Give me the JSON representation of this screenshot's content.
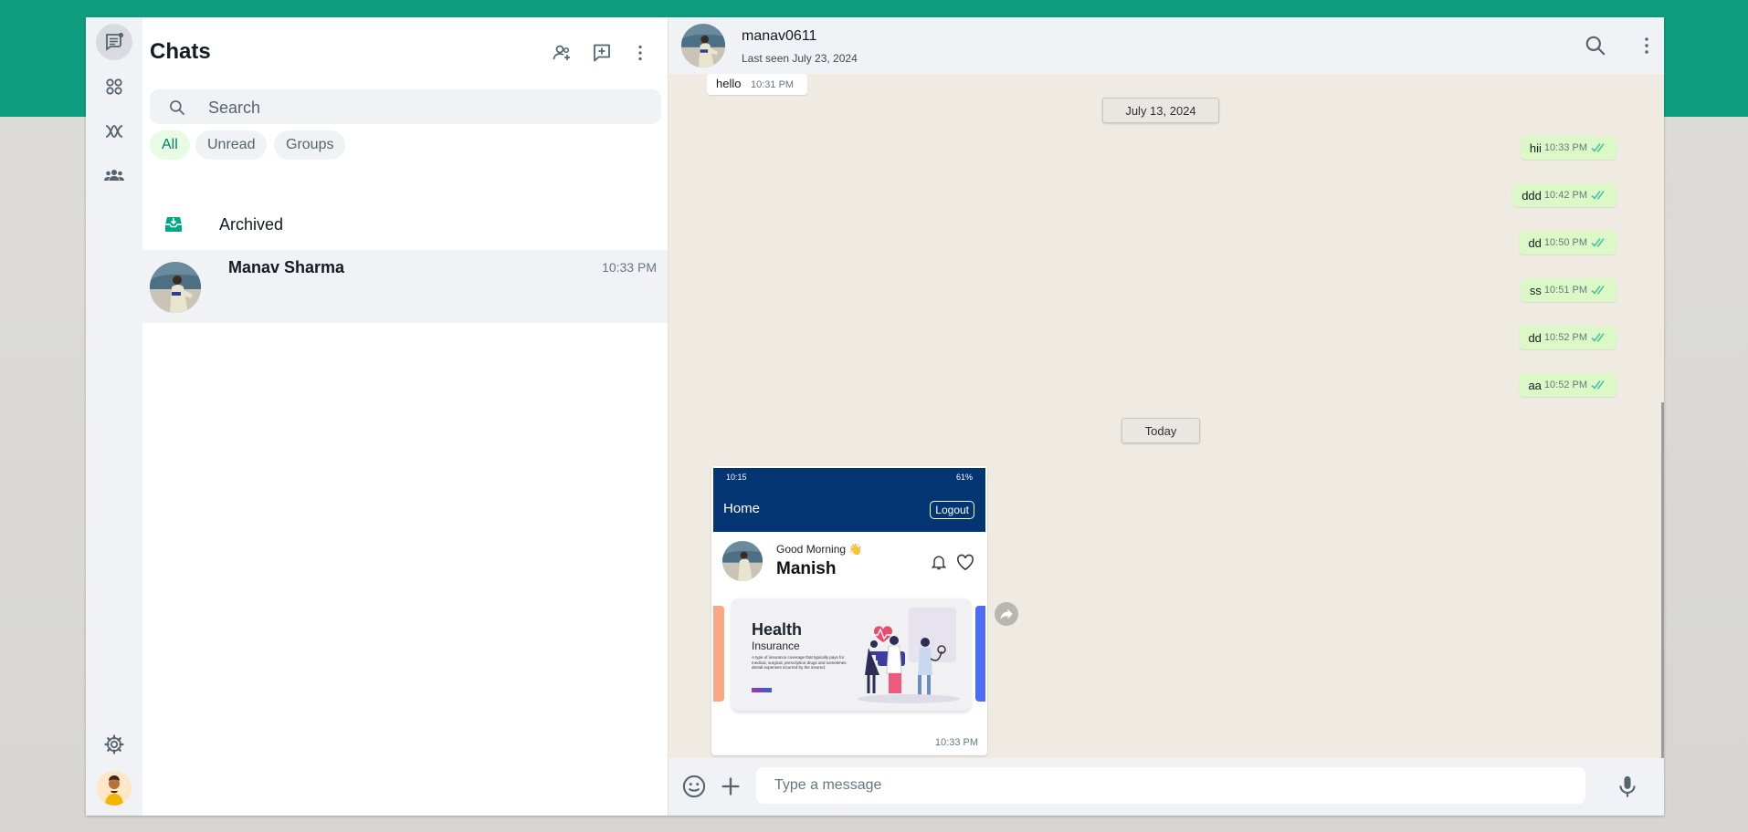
{
  "rail": {
    "items": [
      "chats-icon",
      "status-icon",
      "channels-icon",
      "communities-icon"
    ],
    "settings_icon": "settings-gear-icon",
    "profile_icon": "profile-avatar"
  },
  "list": {
    "title": "Chats",
    "search_placeholder": "Search",
    "filters": [
      "All",
      "Unread",
      "Groups"
    ],
    "active_filter": "All",
    "archived_label": "Archived",
    "chats": [
      {
        "name": "Manav Sharma",
        "time": "10:33 PM"
      }
    ]
  },
  "conversation": {
    "contact_name": "manav0611",
    "status": "Last seen July 23, 2024",
    "incoming": [
      {
        "text": "hello",
        "time": "10:31 PM"
      }
    ],
    "date_chips": [
      "July 13, 2024",
      "Today"
    ],
    "outgoing": [
      {
        "text": "hii",
        "time": "10:33 PM"
      },
      {
        "text": "ddd",
        "time": "10:42 PM"
      },
      {
        "text": "dd",
        "time": "10:50 PM"
      },
      {
        "text": "ss",
        "time": "10:51 PM"
      },
      {
        "text": "dd",
        "time": "10:52 PM"
      },
      {
        "text": "aa",
        "time": "10:52 PM"
      }
    ],
    "image_message": {
      "time": "10:33 PM",
      "screenshot": {
        "status_time": "10:15",
        "status_right": "61%",
        "app_title": "Home",
        "logout": "Logout",
        "greeting": "Good Morning 👋",
        "user": "Manish",
        "banner_title": "Health",
        "banner_subtitle": "Insurance",
        "banner_text": "A type of insurance coverage that typically pays for medical, surgical, prescription drugs and sometimes dental expenses incurred by the insured."
      }
    },
    "composer_placeholder": "Type a message"
  },
  "colors": {
    "brand_green": "#0e9c7e",
    "outgoing_bubble": "#dcf8c6",
    "chat_bg": "#efeae2",
    "tick_blue_green": "#53bdeb"
  }
}
